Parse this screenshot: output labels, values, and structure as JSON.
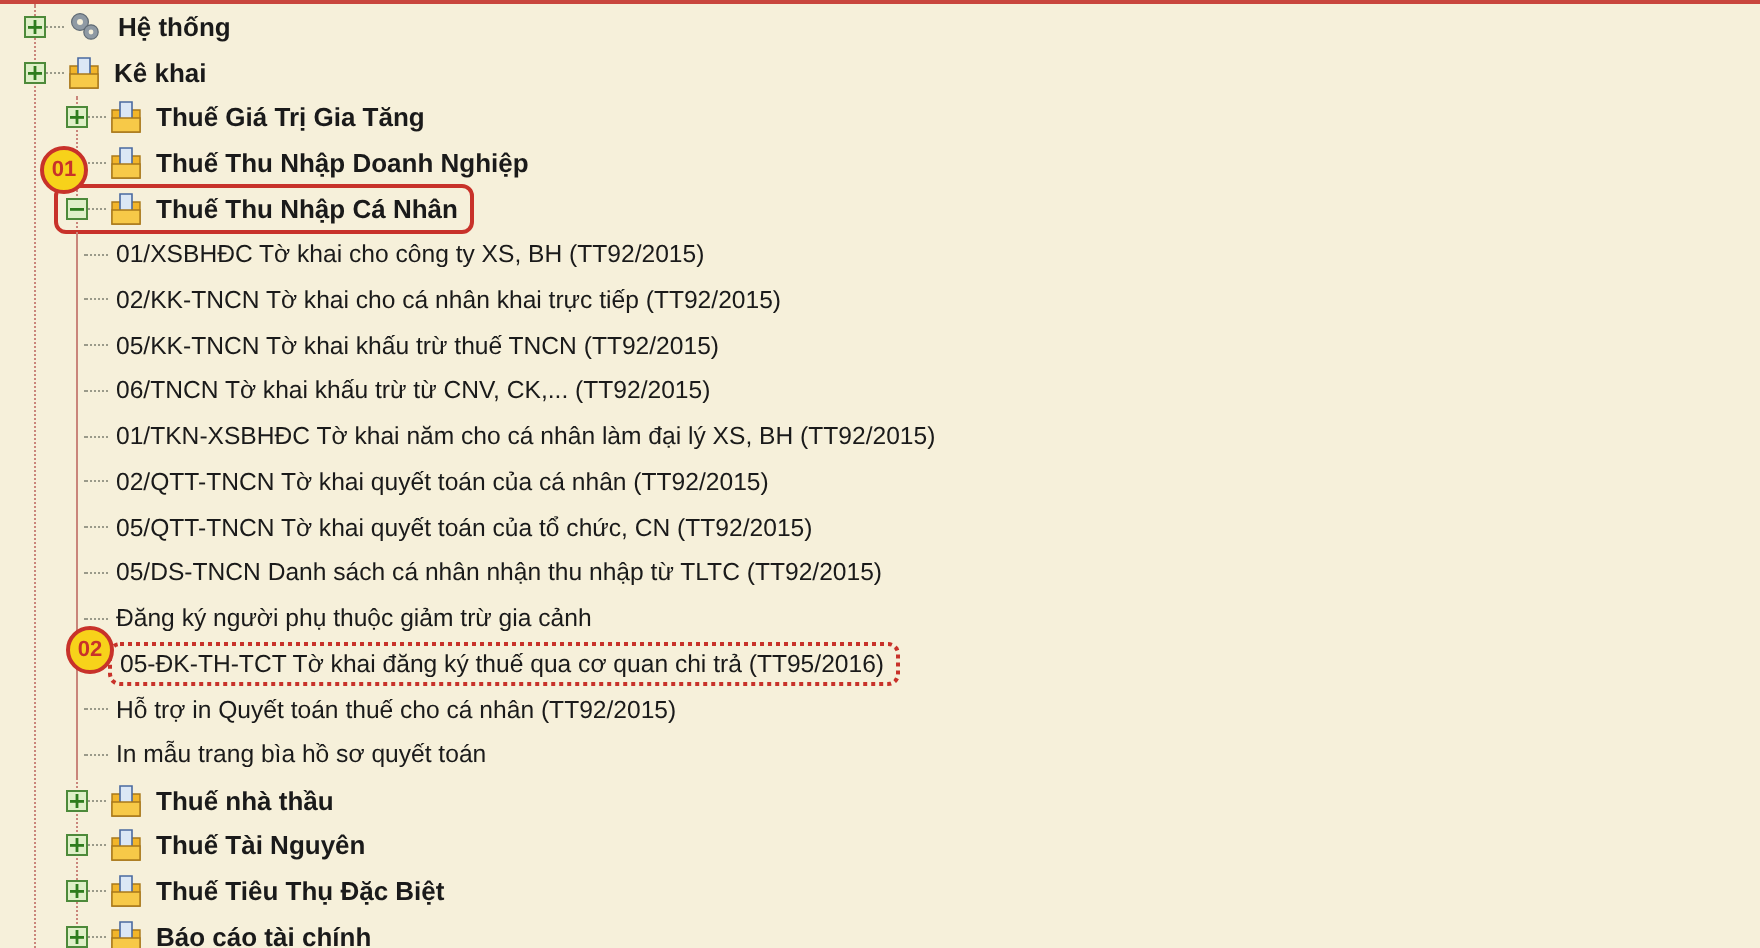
{
  "tree": [
    {
      "kind": "gears",
      "label": "Hệ thống",
      "expanded": false
    },
    {
      "kind": "folder",
      "label": "Kê khai",
      "expanded": false,
      "children": [
        {
          "kind": "folder",
          "label": "Thuế Giá Trị Gia Tăng",
          "expanded": false
        },
        {
          "kind": "folder",
          "label": "Thuế Thu Nhập Doanh Nghiệp"
        },
        {
          "kind": "folder",
          "label": "Thuế Thu Nhập Cá Nhân",
          "expanded": true,
          "callout": {
            "label": "01",
            "dashed": false
          },
          "children": [
            {
              "kind": "leaf",
              "label": "01/XSBHĐC Tờ khai cho công ty XS, BH (TT92/2015)"
            },
            {
              "kind": "leaf",
              "label": "02/KK-TNCN Tờ khai cho cá nhân khai trực tiếp (TT92/2015)"
            },
            {
              "kind": "leaf",
              "label": "05/KK-TNCN Tờ khai khấu trừ thuế TNCN (TT92/2015)"
            },
            {
              "kind": "leaf",
              "label": "06/TNCN Tờ khai khấu trừ từ CNV, CK,... (TT92/2015)"
            },
            {
              "kind": "leaf",
              "label": "01/TKN-XSBHĐC Tờ khai năm cho cá nhân làm đại lý XS, BH (TT92/2015)"
            },
            {
              "kind": "leaf",
              "label": "02/QTT-TNCN Tờ khai quyết toán của cá nhân (TT92/2015)"
            },
            {
              "kind": "leaf",
              "label": "05/QTT-TNCN Tờ khai quyết toán của tổ chức, CN (TT92/2015)"
            },
            {
              "kind": "leaf",
              "label": "05/DS-TNCN Danh sách cá nhân nhận thu nhập từ TLTC (TT92/2015)"
            },
            {
              "kind": "leaf",
              "label": "Đăng ký người phụ thuộc giảm trừ gia cảnh"
            },
            {
              "kind": "leaf",
              "label": "05-ĐK-TH-TCT Tờ khai đăng ký thuế qua cơ quan chi trả (TT95/2016)",
              "callout": {
                "label": "02",
                "dashed": true
              }
            },
            {
              "kind": "leaf",
              "label": "Hỗ trợ in Quyết toán thuế cho cá nhân (TT92/2015)"
            },
            {
              "kind": "leaf",
              "label": "In mẫu trang bìa hồ sơ quyết toán"
            }
          ]
        },
        {
          "kind": "folder",
          "label": "Thuế nhà thầu",
          "expanded": false
        },
        {
          "kind": "folder",
          "label": "Thuế Tài Nguyên",
          "expanded": false
        },
        {
          "kind": "folder",
          "label": "Thuế Tiêu Thụ Đặc Biệt",
          "expanded": false
        },
        {
          "kind": "folder",
          "label": "Báo cáo tài chính",
          "expanded": false
        }
      ]
    }
  ]
}
